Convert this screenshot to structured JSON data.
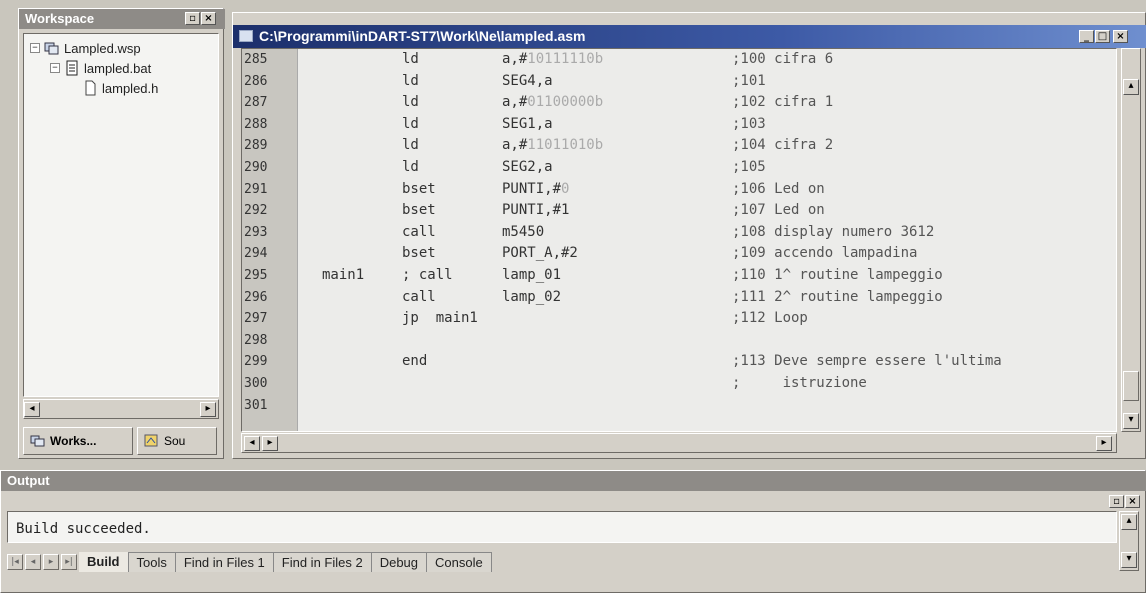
{
  "workspace": {
    "title": "Workspace",
    "tree": [
      {
        "label": "Lampled.wsp",
        "expander": "−",
        "icon": "workspace-icon"
      },
      {
        "label": "lampled.bat",
        "expander": "−",
        "icon": "project-icon"
      },
      {
        "label": "lampled.h",
        "expander": "",
        "icon": "file-icon"
      }
    ],
    "tabs": [
      "Works...",
      "Sou"
    ]
  },
  "editor": {
    "title": "C:\\Programmi\\inDART-ST7\\Work\\Ne\\lampled.asm",
    "lines": [
      {
        "n": "285",
        "label": "",
        "ins": "ld",
        "op": "a,#",
        "lit": "10111110b",
        "cmt": ";100 cifra 6"
      },
      {
        "n": "286",
        "label": "",
        "ins": "ld",
        "op": "SEG4,a",
        "lit": "",
        "cmt": ";101"
      },
      {
        "n": "287",
        "label": "",
        "ins": "ld",
        "op": "a,#",
        "lit": "01100000b",
        "cmt": ";102 cifra 1"
      },
      {
        "n": "288",
        "label": "",
        "ins": "ld",
        "op": "SEG1,a",
        "lit": "",
        "cmt": ";103"
      },
      {
        "n": "289",
        "label": "",
        "ins": "ld",
        "op": "a,#",
        "lit": "11011010b",
        "cmt": ";104 cifra 2"
      },
      {
        "n": "290",
        "label": "",
        "ins": "ld",
        "op": "SEG2,a",
        "lit": "",
        "cmt": ";105"
      },
      {
        "n": "291",
        "label": "",
        "ins": "bset",
        "op": "PUNTI,#",
        "lit": "0",
        "cmt": ";106 Led on"
      },
      {
        "n": "292",
        "label": "",
        "ins": "bset",
        "op": "PUNTI,#1",
        "lit": "",
        "cmt": ";107 Led on"
      },
      {
        "n": "293",
        "label": "",
        "ins": "call",
        "op": "m5450",
        "lit": "",
        "cmt": ";108 display numero 3612"
      },
      {
        "n": "294",
        "label": "",
        "ins": "bset",
        "op": "PORT_A,#2",
        "lit": "",
        "cmt": ";109 accendo lampadina"
      },
      {
        "n": "295",
        "label": "main1",
        "ins": "; call",
        "op": "lamp_01",
        "lit": "",
        "cmt": ";110 1^ routine lampeggio"
      },
      {
        "n": "296",
        "label": "",
        "ins": "call",
        "op": "lamp_02",
        "lit": "",
        "cmt": ";111 2^ routine lampeggio"
      },
      {
        "n": "297",
        "label": "",
        "ins": "jp  main1",
        "op": "",
        "lit": "",
        "cmt": ";112 Loop"
      },
      {
        "n": "298",
        "label": "",
        "ins": "",
        "op": "",
        "lit": "",
        "cmt": ""
      },
      {
        "n": "299",
        "label": "",
        "ins": "end",
        "op": "",
        "lit": "",
        "cmt": ";113 Deve sempre essere l'ultima"
      },
      {
        "n": "300",
        "label": "",
        "ins": "",
        "op": "",
        "lit": "",
        "cmt": ";     istruzione"
      },
      {
        "n": "301",
        "label": "",
        "ins": "",
        "op": "",
        "lit": "",
        "cmt": ""
      }
    ]
  },
  "output": {
    "title": "Output",
    "message": "Build succeeded.",
    "tabs": [
      "Build",
      "Tools",
      "Find in Files 1",
      "Find in Files 2",
      "Debug",
      "Console"
    ],
    "active_tab": "Build"
  }
}
